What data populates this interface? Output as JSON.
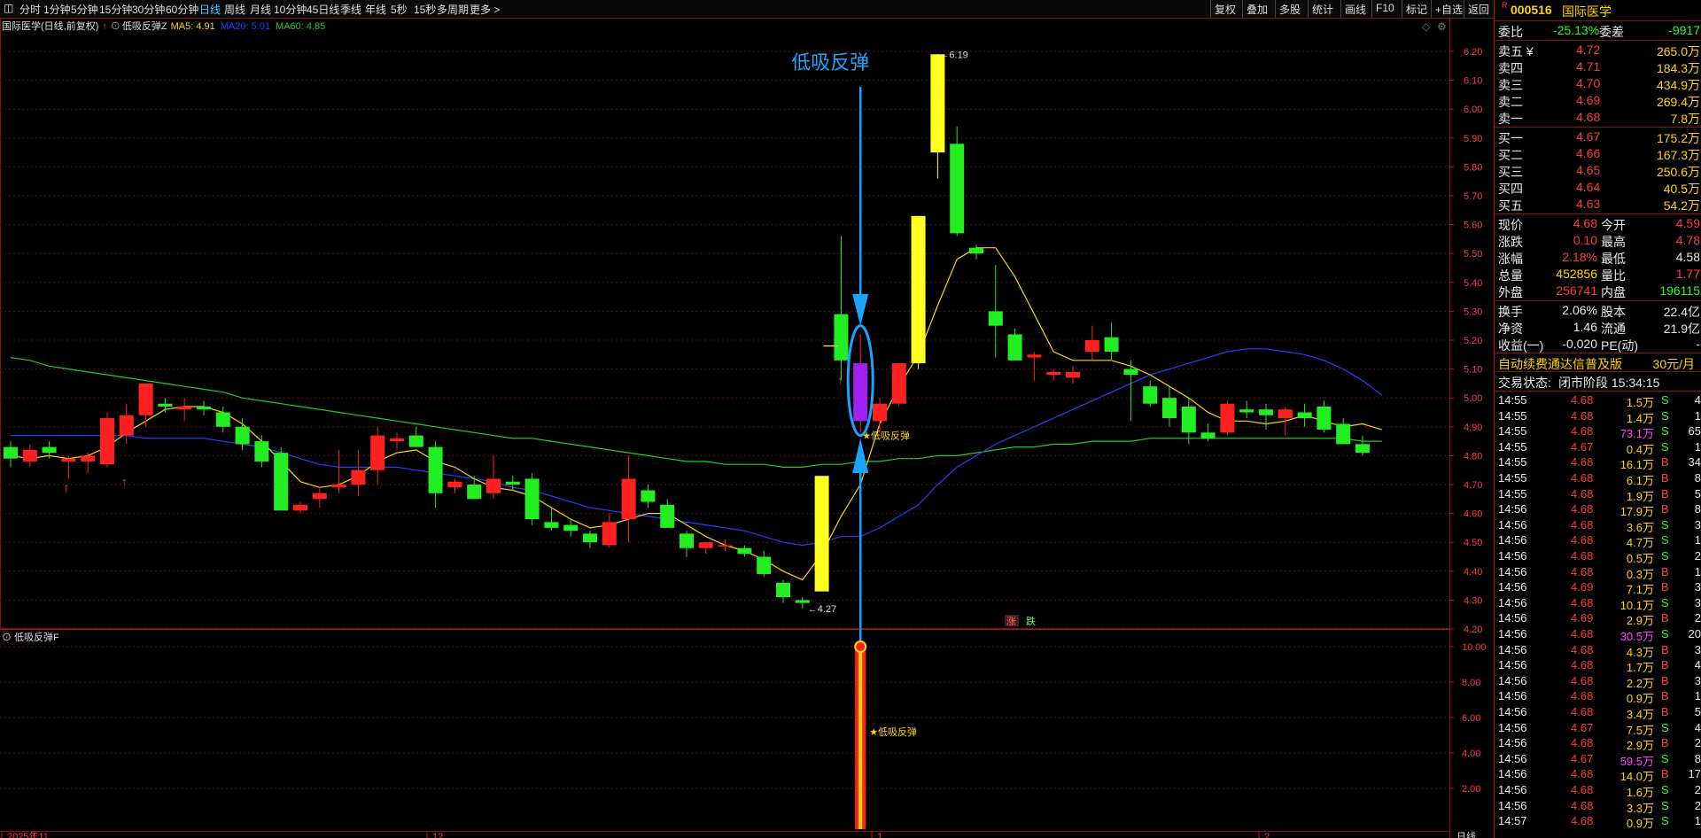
{
  "toolbar": {
    "left_items": [
      "分时",
      "1分钟",
      "5分钟",
      "15分钟",
      "30分钟",
      "60分钟",
      "日线",
      "周线",
      "月线",
      "10分钟",
      "45日线",
      "季线",
      "年线",
      "5秒",
      "15秒",
      "多周期",
      "更多 >"
    ],
    "active": "日线",
    "right_items": [
      "复权",
      "叠加",
      "多股",
      "统计",
      "画线",
      "F10",
      "标记",
      "+自选",
      "返回"
    ]
  },
  "main_chart": {
    "title": "国际医学(日线,前复权)",
    "indicator": "低吸反弹Z",
    "ma5_label": "MA5: 4.91",
    "ma20_label": "MA20: 5.01",
    "ma60_label": "MA60: 4.85",
    "annotation": "低吸反弹",
    "star_label": "★低吸反弹",
    "high_label": "6.19",
    "low_label": "4.27",
    "mini_labels": [
      "涨",
      "跌"
    ],
    "price_ticks": [
      "6.20",
      "6.10",
      "6.00",
      "5.90",
      "5.80",
      "5.70",
      "5.60",
      "5.50",
      "5.40",
      "5.30",
      "5.20",
      "5.10",
      "5.00",
      "4.90",
      "4.80",
      "4.70",
      "4.60",
      "4.50",
      "4.40",
      "4.30",
      "4.20"
    ],
    "colors": {
      "up": "#ff2020",
      "down": "#22ee22",
      "ma5": "#ffd400",
      "ma20": "#2a3cff",
      "ma60": "#22cc22",
      "annot": "#1aa3ff",
      "highlight": "#a020f0",
      "bigbar": "#ffff20"
    }
  },
  "sub_chart": {
    "title": "低吸反弹F",
    "star_label": "★低吸反弹",
    "ticks": [
      "10.00",
      "8.00",
      "6.00",
      "4.00",
      "2.00"
    ]
  },
  "date_axis": [
    "2025年11",
    "12",
    "1",
    "2"
  ],
  "period_label": "日线",
  "chart_data": {
    "type": "candlestick",
    "price_range": [
      4.18,
      6.23
    ],
    "candles": [
      {
        "o": 4.83,
        "h": 4.85,
        "l": 4.76,
        "c": 4.79
      },
      {
        "o": 4.78,
        "h": 4.84,
        "l": 4.76,
        "c": 4.82
      },
      {
        "o": 4.83,
        "h": 4.85,
        "l": 4.79,
        "c": 4.81
      },
      {
        "o": 4.78,
        "h": 4.8,
        "l": 4.72,
        "c": 4.79
      },
      {
        "o": 4.78,
        "h": 4.81,
        "l": 4.74,
        "c": 4.8
      },
      {
        "o": 4.77,
        "h": 4.95,
        "l": 4.76,
        "c": 4.93
      },
      {
        "o": 4.87,
        "h": 4.98,
        "l": 4.84,
        "c": 4.94
      },
      {
        "o": 4.94,
        "h": 5.0,
        "l": 4.9,
        "c": 5.05
      },
      {
        "o": 4.98,
        "h": 5.0,
        "l": 4.95,
        "c": 4.97
      },
      {
        "o": 4.96,
        "h": 5.0,
        "l": 4.92,
        "c": 4.97
      },
      {
        "o": 4.97,
        "h": 4.99,
        "l": 4.94,
        "c": 4.96
      },
      {
        "o": 4.95,
        "h": 4.97,
        "l": 4.88,
        "c": 4.9
      },
      {
        "o": 4.9,
        "h": 4.93,
        "l": 4.82,
        "c": 4.84
      },
      {
        "o": 4.85,
        "h": 4.87,
        "l": 4.76,
        "c": 4.78
      },
      {
        "o": 4.81,
        "h": 4.83,
        "l": 4.62,
        "c": 4.61
      },
      {
        "o": 4.61,
        "h": 4.64,
        "l": 4.6,
        "c": 4.63
      },
      {
        "o": 4.65,
        "h": 4.69,
        "l": 4.62,
        "c": 4.67
      },
      {
        "o": 4.69,
        "h": 4.82,
        "l": 4.67,
        "c": 4.7
      },
      {
        "o": 4.7,
        "h": 4.82,
        "l": 4.66,
        "c": 4.75
      },
      {
        "o": 4.75,
        "h": 4.9,
        "l": 4.7,
        "c": 4.87
      },
      {
        "o": 4.85,
        "h": 4.88,
        "l": 4.82,
        "c": 4.86
      },
      {
        "o": 4.87,
        "h": 4.9,
        "l": 4.83,
        "c": 4.83
      },
      {
        "o": 4.83,
        "h": 4.85,
        "l": 4.62,
        "c": 4.67
      },
      {
        "o": 4.69,
        "h": 4.72,
        "l": 4.67,
        "c": 4.71
      },
      {
        "o": 4.7,
        "h": 4.73,
        "l": 4.66,
        "c": 4.65
      },
      {
        "o": 4.67,
        "h": 4.8,
        "l": 4.65,
        "c": 4.72
      },
      {
        "o": 4.71,
        "h": 4.73,
        "l": 4.68,
        "c": 4.7
      },
      {
        "o": 4.72,
        "h": 4.74,
        "l": 4.56,
        "c": 4.58
      },
      {
        "o": 4.57,
        "h": 4.62,
        "l": 4.54,
        "c": 4.55
      },
      {
        "o": 4.56,
        "h": 4.58,
        "l": 4.52,
        "c": 4.54
      },
      {
        "o": 4.53,
        "h": 4.54,
        "l": 4.48,
        "c": 4.5
      },
      {
        "o": 4.49,
        "h": 4.6,
        "l": 4.48,
        "c": 4.57
      },
      {
        "o": 4.58,
        "h": 4.8,
        "l": 4.5,
        "c": 4.72
      },
      {
        "o": 4.68,
        "h": 4.7,
        "l": 4.62,
        "c": 4.64
      },
      {
        "o": 4.63,
        "h": 4.65,
        "l": 4.55,
        "c": 4.55
      },
      {
        "o": 4.53,
        "h": 4.54,
        "l": 4.45,
        "c": 4.48
      },
      {
        "o": 4.48,
        "h": 4.5,
        "l": 4.46,
        "c": 4.5
      },
      {
        "o": 4.49,
        "h": 4.51,
        "l": 4.47,
        "c": 4.49
      },
      {
        "o": 4.48,
        "h": 4.49,
        "l": 4.45,
        "c": 4.46
      },
      {
        "o": 4.45,
        "h": 4.47,
        "l": 4.38,
        "c": 4.39
      },
      {
        "o": 4.36,
        "h": 4.37,
        "l": 4.29,
        "c": 4.31
      },
      {
        "o": 4.3,
        "h": 4.31,
        "l": 4.27,
        "c": 4.29
      },
      {
        "o": 4.33,
        "h": 4.73,
        "l": 4.33,
        "c": 4.73,
        "big": true
      },
      {
        "o": 5.29,
        "h": 5.56,
        "l": 5.06,
        "c": 5.13
      },
      {
        "o": 5.12,
        "h": 5.22,
        "l": 4.88,
        "c": 4.92,
        "highlight": true
      },
      {
        "o": 4.92,
        "h": 5.0,
        "l": 4.88,
        "c": 4.98
      },
      {
        "o": 4.98,
        "h": 5.12,
        "l": 4.97,
        "c": 5.12
      },
      {
        "o": 5.12,
        "h": 5.63,
        "l": 5.1,
        "c": 5.63,
        "big": true
      },
      {
        "o": 5.85,
        "h": 6.19,
        "l": 5.76,
        "c": 6.19,
        "big": true
      },
      {
        "o": 5.88,
        "h": 5.94,
        "l": 5.56,
        "c": 5.57
      },
      {
        "o": 5.52,
        "h": 5.53,
        "l": 5.48,
        "c": 5.5
      },
      {
        "o": 5.3,
        "h": 5.46,
        "l": 5.14,
        "c": 5.25
      },
      {
        "o": 5.22,
        "h": 5.24,
        "l": 5.13,
        "c": 5.13
      },
      {
        "o": 5.14,
        "h": 5.16,
        "l": 5.06,
        "c": 5.15
      },
      {
        "o": 5.08,
        "h": 5.1,
        "l": 5.06,
        "c": 5.09
      },
      {
        "o": 5.07,
        "h": 5.11,
        "l": 5.05,
        "c": 5.09
      },
      {
        "o": 5.16,
        "h": 5.25,
        "l": 5.13,
        "c": 5.2
      },
      {
        "o": 5.21,
        "h": 5.26,
        "l": 5.13,
        "c": 5.16
      },
      {
        "o": 5.1,
        "h": 5.13,
        "l": 4.92,
        "c": 5.08
      },
      {
        "o": 5.04,
        "h": 5.06,
        "l": 4.97,
        "c": 4.98
      },
      {
        "o": 5.0,
        "h": 5.04,
        "l": 4.9,
        "c": 4.93
      },
      {
        "o": 4.97,
        "h": 5.0,
        "l": 4.84,
        "c": 4.88
      },
      {
        "o": 4.88,
        "h": 4.91,
        "l": 4.85,
        "c": 4.86
      },
      {
        "o": 4.88,
        "h": 4.99,
        "l": 4.87,
        "c": 4.98
      },
      {
        "o": 4.96,
        "h": 4.99,
        "l": 4.93,
        "c": 4.95
      },
      {
        "o": 4.96,
        "h": 4.98,
        "l": 4.89,
        "c": 4.94
      },
      {
        "o": 4.93,
        "h": 4.97,
        "l": 4.87,
        "c": 4.96
      },
      {
        "o": 4.95,
        "h": 4.98,
        "l": 4.9,
        "c": 4.93
      },
      {
        "o": 4.97,
        "h": 4.99,
        "l": 4.88,
        "c": 4.89
      },
      {
        "o": 4.91,
        "h": 4.93,
        "l": 4.86,
        "c": 4.84
      },
      {
        "o": 4.84,
        "h": 4.87,
        "l": 4.8,
        "c": 4.81
      }
    ],
    "ma5": [
      4.8,
      4.79,
      4.8,
      4.79,
      4.8,
      4.83,
      4.88,
      4.92,
      4.96,
      4.97,
      4.97,
      4.95,
      4.91,
      4.85,
      4.78,
      4.71,
      4.69,
      4.7,
      4.73,
      4.78,
      4.81,
      4.82,
      4.78,
      4.76,
      4.72,
      4.69,
      4.68,
      4.66,
      4.62,
      4.58,
      4.55,
      4.56,
      4.58,
      4.6,
      4.6,
      4.56,
      4.52,
      4.49,
      4.47,
      4.44,
      4.4,
      4.37,
      4.46,
      4.59,
      4.7,
      4.91,
      5.04,
      5.15,
      5.32,
      5.48,
      5.52,
      5.52,
      5.42,
      5.29,
      5.16,
      5.13,
      5.13,
      5.13,
      5.11,
      5.08,
      5.04,
      5.0,
      4.95,
      4.92,
      4.92,
      4.91,
      4.92,
      4.94,
      4.92,
      4.9,
      4.91,
      4.89
    ],
    "ma20": [
      4.87,
      4.87,
      4.87,
      4.87,
      4.87,
      4.87,
      4.87,
      4.86,
      4.86,
      4.86,
      4.86,
      4.85,
      4.84,
      4.83,
      4.81,
      4.79,
      4.77,
      4.76,
      4.76,
      4.76,
      4.76,
      4.75,
      4.74,
      4.73,
      4.72,
      4.71,
      4.69,
      4.68,
      4.66,
      4.64,
      4.62,
      4.61,
      4.6,
      4.59,
      4.58,
      4.57,
      4.56,
      4.55,
      4.54,
      4.52,
      4.5,
      4.49,
      4.5,
      4.52,
      4.52,
      4.55,
      4.59,
      4.63,
      4.7,
      4.76,
      4.8,
      4.84,
      4.87,
      4.9,
      4.93,
      4.96,
      4.99,
      5.02,
      5.05,
      5.08,
      5.1,
      5.12,
      5.14,
      5.16,
      5.17,
      5.17,
      5.16,
      5.15,
      5.13,
      5.1,
      5.06,
      5.01
    ],
    "ma60": [
      5.14,
      5.13,
      5.11,
      5.1,
      5.09,
      5.08,
      5.07,
      5.06,
      5.05,
      5.04,
      5.03,
      5.02,
      5.0,
      4.99,
      4.98,
      4.97,
      4.96,
      4.95,
      4.94,
      4.93,
      4.92,
      4.91,
      4.9,
      4.89,
      4.88,
      4.87,
      4.86,
      4.86,
      4.85,
      4.84,
      4.83,
      4.82,
      4.81,
      4.8,
      4.79,
      4.78,
      4.78,
      4.77,
      4.77,
      4.77,
      4.76,
      4.76,
      4.77,
      4.77,
      4.78,
      4.78,
      4.79,
      4.79,
      4.8,
      4.8,
      4.81,
      4.82,
      4.83,
      4.83,
      4.84,
      4.84,
      4.85,
      4.85,
      4.85,
      4.86,
      4.86,
      4.86,
      4.86,
      4.86,
      4.86,
      4.86,
      4.86,
      4.86,
      4.86,
      4.86,
      4.85,
      4.85
    ],
    "signal_index": 44,
    "signal_value": 10.0
  },
  "quote": {
    "code": "000516",
    "name": "国际医学",
    "wb_label": "委比",
    "wb_value": "-25.13%",
    "wc_label": "委差",
    "wc_value": "-9917",
    "asks": [
      {
        "label": "卖五 ¥",
        "price": "4.72",
        "vol": "265.0万"
      },
      {
        "label": "卖四",
        "price": "4.71",
        "vol": "184.3万"
      },
      {
        "label": "卖三",
        "price": "4.70",
        "vol": "434.9万"
      },
      {
        "label": "卖二",
        "price": "4.69",
        "vol": "269.4万"
      },
      {
        "label": "卖一",
        "price": "4.68",
        "vol": "7.8万"
      }
    ],
    "bids": [
      {
        "label": "买一",
        "price": "4.67",
        "vol": "175.2万"
      },
      {
        "label": "买二",
        "price": "4.66",
        "vol": "167.3万"
      },
      {
        "label": "买三",
        "price": "4.65",
        "vol": "250.6万"
      },
      {
        "label": "买四",
        "price": "4.64",
        "vol": "40.5万"
      },
      {
        "label": "买五",
        "price": "4.63",
        "vol": "54.2万"
      }
    ],
    "stats": [
      {
        "l1": "现价",
        "v1": "4.68",
        "c1": "red",
        "l2": "今开",
        "v2": "4.59",
        "c2": "red"
      },
      {
        "l1": "涨跌",
        "v1": "0.10",
        "c1": "red",
        "l2": "最高",
        "v2": "4.78",
        "c2": "red"
      },
      {
        "l1": "涨幅",
        "v1": "2.18%",
        "c1": "red",
        "l2": "最低",
        "v2": "4.58",
        "c2": "white"
      },
      {
        "l1": "总量",
        "v1": "452856",
        "c1": "yellow",
        "l2": "量比",
        "v2": "1.77",
        "c2": "red"
      },
      {
        "l1": "外盘",
        "v1": "256741",
        "c1": "red",
        "l2": "内盘",
        "v2": "196115",
        "c2": "green"
      }
    ],
    "stats2": [
      {
        "l1": "换手",
        "v1": "2.06%",
        "l2": "股本",
        "v2": "22.4亿"
      },
      {
        "l1": "净资",
        "v1": "1.46",
        "l2": "流通",
        "v2": "21.9亿"
      },
      {
        "l1": "收益(一)",
        "v1": "-0.020",
        "l2": "PE(动)",
        "v2": "-"
      }
    ],
    "ad_text": "自动续费通达信普及版",
    "ad_price": "30元/月",
    "status_label": "交易状态:",
    "status_value": "闭市阶段 15:34:15",
    "ticks": [
      {
        "t": "14:55",
        "p": "4.68",
        "v": "1.5万",
        "s": "S",
        "n": "4",
        "pc": "red",
        "vc": "yellow"
      },
      {
        "t": "14:55",
        "p": "4.68",
        "v": "1.4万",
        "s": "S",
        "n": "1",
        "pc": "red",
        "vc": "yellow"
      },
      {
        "t": "14:55",
        "p": "4.68",
        "v": "73.1万",
        "s": "S",
        "n": "65",
        "pc": "red",
        "vc": "magenta"
      },
      {
        "t": "14:55",
        "p": "4.67",
        "v": "0.4万",
        "s": "S",
        "n": "1",
        "pc": "red",
        "vc": "yellow"
      },
      {
        "t": "14:55",
        "p": "4.68",
        "v": "16.1万",
        "s": "B",
        "n": "34",
        "pc": "red",
        "vc": "yellow"
      },
      {
        "t": "14:55",
        "p": "4.68",
        "v": "6.1万",
        "s": "B",
        "n": "8",
        "pc": "red",
        "vc": "yellow"
      },
      {
        "t": "14:55",
        "p": "4.68",
        "v": "1.9万",
        "s": "B",
        "n": "5",
        "pc": "red",
        "vc": "yellow"
      },
      {
        "t": "14:56",
        "p": "4.68",
        "v": "17.9万",
        "s": "B",
        "n": "8",
        "pc": "red",
        "vc": "yellow"
      },
      {
        "t": "14:56",
        "p": "4.68",
        "v": "3.6万",
        "s": "S",
        "n": "3",
        "pc": "red",
        "vc": "yellow"
      },
      {
        "t": "14:56",
        "p": "4.68",
        "v": "4.7万",
        "s": "S",
        "n": "1",
        "pc": "red",
        "vc": "yellow"
      },
      {
        "t": "14:56",
        "p": "4.68",
        "v": "0.5万",
        "s": "S",
        "n": "2",
        "pc": "red",
        "vc": "yellow"
      },
      {
        "t": "14:56",
        "p": "4.68",
        "v": "0.3万",
        "s": "B",
        "n": "1",
        "pc": "red",
        "vc": "yellow"
      },
      {
        "t": "14:56",
        "p": "4.69",
        "v": "7.1万",
        "s": "B",
        "n": "3",
        "pc": "red",
        "vc": "yellow"
      },
      {
        "t": "14:56",
        "p": "4.68",
        "v": "10.1万",
        "s": "S",
        "n": "3",
        "pc": "red",
        "vc": "yellow"
      },
      {
        "t": "14:56",
        "p": "4.69",
        "v": "2.9万",
        "s": "B",
        "n": "2",
        "pc": "red",
        "vc": "yellow"
      },
      {
        "t": "14:56",
        "p": "4.68",
        "v": "30.5万",
        "s": "S",
        "n": "20",
        "pc": "red",
        "vc": "magenta"
      },
      {
        "t": "14:56",
        "p": "4.68",
        "v": "4.3万",
        "s": "B",
        "n": "3",
        "pc": "red",
        "vc": "yellow"
      },
      {
        "t": "14:56",
        "p": "4.68",
        "v": "1.7万",
        "s": "B",
        "n": "4",
        "pc": "red",
        "vc": "yellow"
      },
      {
        "t": "14:56",
        "p": "4.68",
        "v": "2.2万",
        "s": "B",
        "n": "3",
        "pc": "red",
        "vc": "yellow"
      },
      {
        "t": "14:56",
        "p": "4.68",
        "v": "0.9万",
        "s": "B",
        "n": "1",
        "pc": "red",
        "vc": "yellow"
      },
      {
        "t": "14:56",
        "p": "4.68",
        "v": "3.4万",
        "s": "B",
        "n": "5",
        "pc": "red",
        "vc": "yellow"
      },
      {
        "t": "14:56",
        "p": "4.67",
        "v": "7.5万",
        "s": "S",
        "n": "4",
        "pc": "red",
        "vc": "yellow"
      },
      {
        "t": "14:56",
        "p": "4.68",
        "v": "2.9万",
        "s": "B",
        "n": "2",
        "pc": "red",
        "vc": "yellow"
      },
      {
        "t": "14:56",
        "p": "4.67",
        "v": "59.5万",
        "s": "S",
        "n": "8",
        "pc": "red",
        "vc": "magenta"
      },
      {
        "t": "14:56",
        "p": "4.68",
        "v": "14.0万",
        "s": "B",
        "n": "17",
        "pc": "red",
        "vc": "yellow"
      },
      {
        "t": "14:56",
        "p": "4.68",
        "v": "1.6万",
        "s": "S",
        "n": "2",
        "pc": "red",
        "vc": "yellow"
      },
      {
        "t": "14:56",
        "p": "4.68",
        "v": "3.3万",
        "s": "S",
        "n": "2",
        "pc": "red",
        "vc": "yellow"
      },
      {
        "t": "14:57",
        "p": "4.68",
        "v": "0.9万",
        "s": "S",
        "n": "1",
        "pc": "red",
        "vc": "yellow"
      }
    ]
  }
}
